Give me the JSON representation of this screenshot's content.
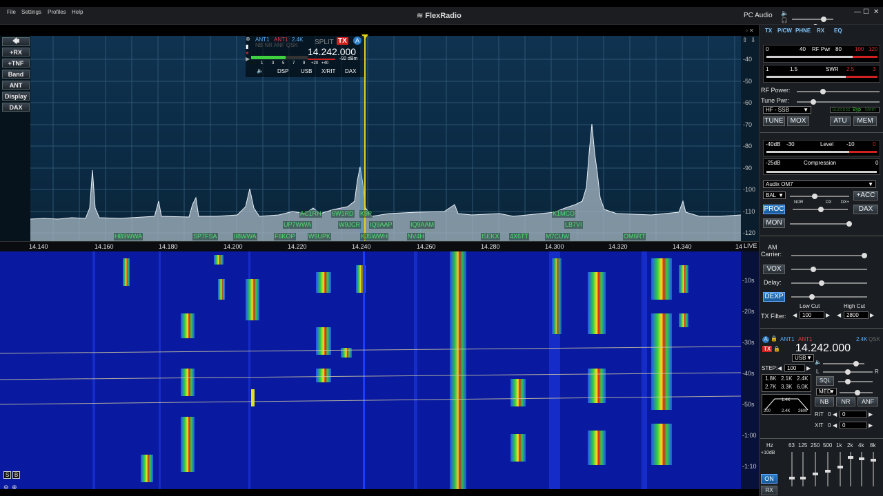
{
  "menu": {
    "file": "File",
    "settings": "Settings",
    "profiles": "Profiles",
    "help": "Help"
  },
  "app": {
    "brand": "FlexRadio",
    "pc_audio": "PC Audio"
  },
  "left_buttons": [
    "+RX",
    "+TNF",
    "Band",
    "ANT",
    "Display",
    "DAX"
  ],
  "panadapter": {
    "db_labels": [
      "-40",
      "-50",
      "-60",
      "-70",
      "-80",
      "-90",
      "-100",
      "-110",
      "-120"
    ],
    "freq_labels": [
      "14.140",
      "14.160",
      "14.180",
      "14.200",
      "14.220",
      "14.240",
      "14.260",
      "14.280",
      "14.300",
      "14.320",
      "14.340",
      "14"
    ],
    "live": "LIVE",
    "spots_row1": [
      "AC1RH",
      "6W1RD",
      "K9P",
      "K1MCO"
    ],
    "spots_row2": [
      "UP7WWA",
      "W9JCR",
      "IQ9AAP",
      "IQ9AAM",
      "LB7VI"
    ],
    "spots_row3": [
      "HB9WWA",
      "SP7FSA",
      "II8WWA",
      "F6KOP",
      "W9UPK",
      "KJ5WWH",
      "NV4H",
      "I5EKX",
      "4X6TT",
      "M7CUW",
      "OM6RT"
    ]
  },
  "slice_flag": {
    "ant_rx": "ANT1",
    "ant_tx": "ANT1",
    "bw": "2.4K",
    "split": "SPLIT",
    "tx": "TX",
    "slice": "A",
    "flags": "NB NR ANF QSK",
    "frequency": "14.242.000",
    "level": "-92 dBm",
    "scale": [
      "1",
      "3",
      "5",
      "7",
      "9",
      "+20",
      "+40"
    ],
    "tabs": [
      "DSP",
      "USB",
      "X/RIT",
      "DAX"
    ]
  },
  "waterfall": {
    "time_labels": [
      "-10s",
      "-20s",
      "-30s",
      "-40s",
      "-50s",
      "-1:00",
      "-1:10"
    ],
    "btn_s": "S",
    "btn_b": "B"
  },
  "right_panel": {
    "tabs": [
      "TX",
      "P/CW",
      "PHNE",
      "RX",
      "EQ"
    ],
    "rf_meter": {
      "scale": [
        "0",
        "40",
        "RF Pwr",
        "80",
        "100",
        "120"
      ]
    },
    "swr_meter": {
      "scale": [
        "1",
        "1.5",
        "SWR",
        "2.5",
        "3"
      ]
    },
    "rf_power": "RF Power:",
    "tune_pwr": "Tune Pwr:",
    "profile": "HF - SSB",
    "status": [
      "Success",
      "Byp",
      "Mem"
    ],
    "buttons": {
      "tune": "TUNE",
      "mox": "MOX",
      "atu": "ATU",
      "mem": "MEM"
    },
    "level_meter": {
      "scale": [
        "-40dB",
        "-30",
        "Level",
        "-10",
        "0"
      ]
    },
    "comp_meter": {
      "scale": [
        "-25dB",
        "Compression",
        "0"
      ]
    },
    "mic_profile": "Audix OM7",
    "bal": "BAL",
    "acc": "+ACC",
    "proc": "PROC",
    "dax": "DAX",
    "mon": "MON",
    "proc_scale": [
      "NOR",
      "DX",
      "DX+"
    ],
    "am": "AM",
    "carrier": "Carrier:",
    "vox": "VOX",
    "delay": "Delay:",
    "dexp": "DEXP",
    "low_cut": "Low Cut",
    "high_cut": "High Cut",
    "tx_filter": "TX Filter:",
    "low_value": "100",
    "high_value": "2800"
  },
  "slice_panel": {
    "ant_rx": "ANT1",
    "ant_tx": "ANT1",
    "bw": "2.4K",
    "qsk": "QSK",
    "frequency": "14.242.000",
    "mode": "USB",
    "step_label": "STEP:",
    "step": "100",
    "filters": [
      "1.8K",
      "2.1K",
      "2.4K",
      "2.7K",
      "3.3K",
      "6.0K"
    ],
    "l": "L",
    "r": "R",
    "sql": "SQL",
    "agc": "MED",
    "filter_width": "1.4K",
    "filter_scale": [
      "200",
      "2.4K",
      "2600"
    ],
    "nb": "NB",
    "nr": "NR",
    "anf": "ANF",
    "rit": "RIT",
    "rit_value": "0",
    "xit": "XIT",
    "xit_value": "0"
  },
  "eq": {
    "bands": [
      "Hz",
      "63",
      "125",
      "250",
      "500",
      "1k",
      "2k",
      "4k",
      "8k"
    ],
    "gain": "+10dB",
    "on": "ON",
    "rx": "RX"
  }
}
